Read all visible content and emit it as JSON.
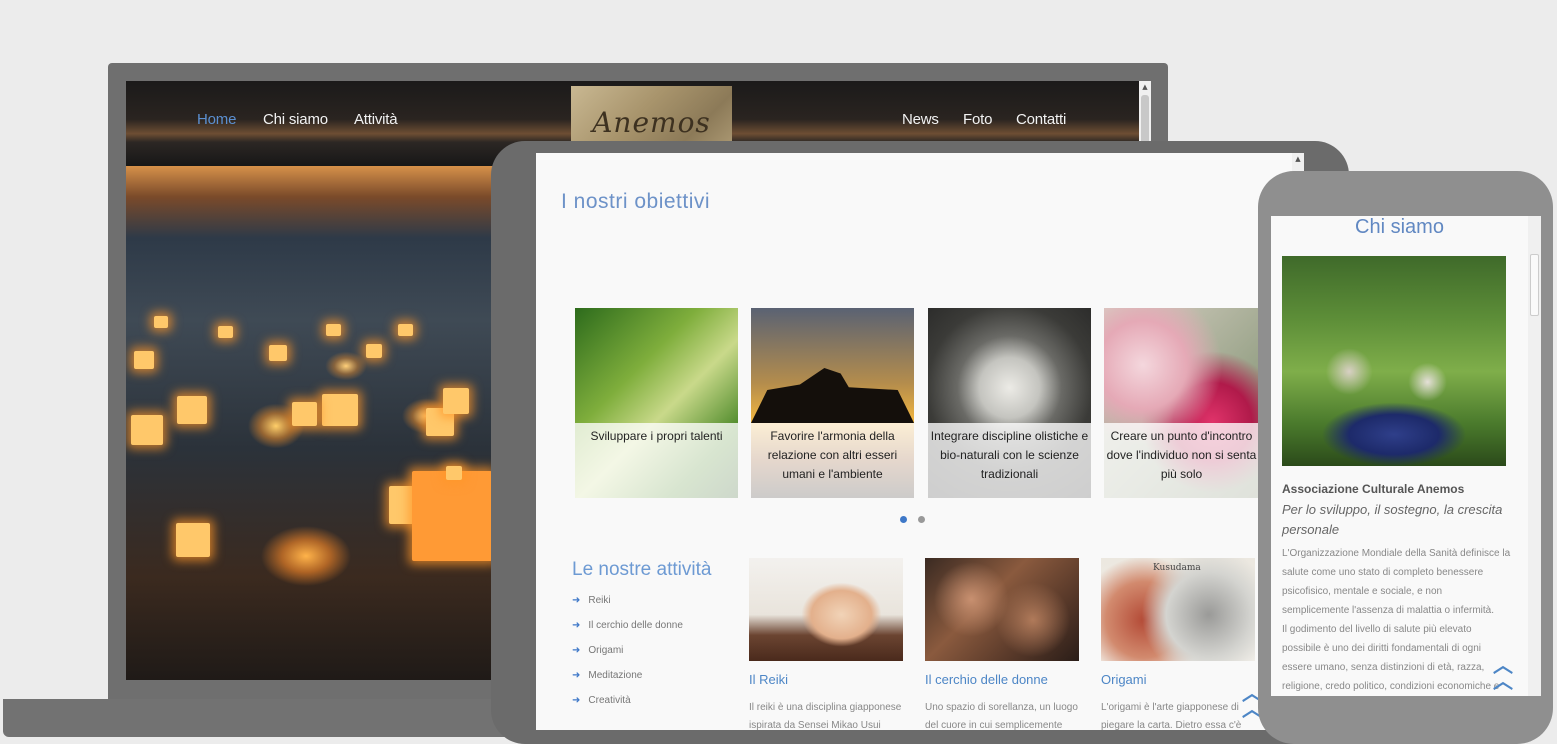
{
  "laptop": {
    "nav_left": [
      "Home",
      "Chi siamo",
      "Attività"
    ],
    "nav_right": [
      "News",
      "Foto",
      "Contatti"
    ],
    "logo_text": "Anemos",
    "active_nav": "Home"
  },
  "tablet": {
    "section_title": "I nostri obiettivi",
    "slides": [
      {
        "caption": "Sviluppare i propri talenti"
      },
      {
        "caption": "Favorire l'armonia della relazione con altri esseri umani e l'ambiente"
      },
      {
        "caption": "Integrare discipline olistiche e bio-naturali con le scienze tradizionali"
      },
      {
        "caption": "Creare un punto d'incontro dove l'individuo non si senta più solo"
      }
    ],
    "activities_title": "Le nostre attività",
    "activities": [
      "Reiki",
      "Il cerchio delle donne",
      "Origami",
      "Meditazione",
      "Creatività"
    ],
    "cards": [
      {
        "title": "Il Reiki",
        "text": "Il reiki è una disciplina giapponese ispirata da Sensei Mikao Usui"
      },
      {
        "title": "Il cerchio delle donne",
        "text": "Uno spazio di sorellanza, un luogo del cuore in cui semplicemente"
      },
      {
        "title": "Origami",
        "text": "L'origami è l'arte giapponese di piegare la carta. Dietro essa c'è"
      }
    ],
    "card3_label": "Kusudama"
  },
  "phone": {
    "title": "Chi siamo",
    "org": "Associazione Culturale Anemos",
    "tagline": "Per lo sviluppo, il sostegno, la crescita personale",
    "body_lines": [
      "L'Organizzazione Mondiale della Sanità definisce la",
      "salute come uno stato di completo benessere",
      "psicofisico, mentale e sociale, e non",
      "semplicemente l'assenza di malattia o infermità.",
      "Il godimento del livello di salute più elevato",
      "possibile è uno dei diritti fondamentali di ogni",
      "essere umano, senza distinzioni di età, razza,",
      "religione, credo politico, condizioni economiche e"
    ]
  },
  "colors": {
    "accent": "#5b8fd0",
    "background": "#ececec",
    "device_grey": "#6f6f6f"
  },
  "icons": [
    "arrow-right-icon",
    "double-chevron-up-icon",
    "scroll-up-arrow-icon"
  ]
}
